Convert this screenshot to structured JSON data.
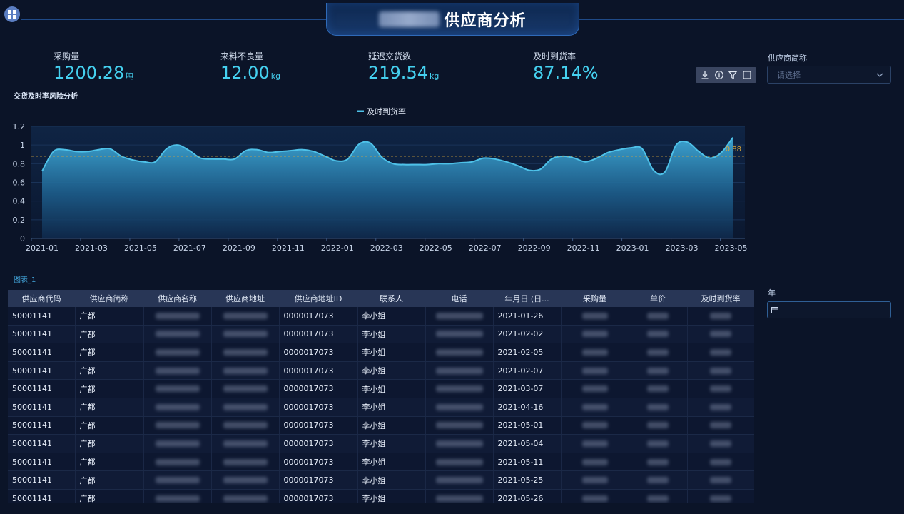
{
  "header": {
    "title": "供应商分析",
    "menu_icon": "grid-icon"
  },
  "kpis": [
    {
      "label": "采购量",
      "value": "1200.28",
      "unit": "吨"
    },
    {
      "label": "来料不良量",
      "value": "12.00",
      "unit": "kg"
    },
    {
      "label": "延迟交货数",
      "value": "219.54",
      "unit": "kg"
    },
    {
      "label": "及时到货率",
      "value": "87.14%",
      "unit": ""
    }
  ],
  "toolbar": {
    "icons": [
      "download-icon",
      "info-icon",
      "filter-icon",
      "fullscreen-icon"
    ]
  },
  "filters": {
    "supplier": {
      "label": "供应商简称",
      "placeholder": "请选择"
    },
    "year": {
      "label": "年",
      "value": ""
    }
  },
  "chart": {
    "section_title": "交货及时率风险分析",
    "legend": "及时到货率",
    "reference_label": "0.88"
  },
  "chart_data": {
    "type": "area",
    "series": [
      {
        "name": "及时到货率",
        "values": [
          0.72,
          0.93,
          0.95,
          0.93,
          0.93,
          0.95,
          0.96,
          0.88,
          0.84,
          0.82,
          0.82,
          0.96,
          1.0,
          0.94,
          0.86,
          0.85,
          0.85,
          0.85,
          0.94,
          0.95,
          0.92,
          0.93,
          0.94,
          0.95,
          0.93,
          0.88,
          0.83,
          0.85,
          1.01,
          1.02,
          0.87,
          0.8,
          0.79,
          0.79,
          0.79,
          0.8,
          0.8,
          0.81,
          0.82,
          0.86,
          0.85,
          0.82,
          0.78,
          0.73,
          0.74,
          0.85,
          0.88,
          0.86,
          0.82,
          0.86,
          0.92,
          0.95,
          0.97,
          0.96,
          0.73,
          0.71,
          1.0,
          1.03,
          0.93,
          0.86,
          0.92,
          1.08
        ],
        "color": "#4ec1e8"
      }
    ],
    "x_ticks": [
      "2021-01",
      "2021-03",
      "2021-05",
      "2021-07",
      "2021-09",
      "2021-11",
      "2022-01",
      "2022-03",
      "2022-05",
      "2022-07",
      "2022-09",
      "2022-11",
      "2023-01",
      "2023-03",
      "2023-05"
    ],
    "y_ticks": [
      "0",
      "0.2",
      "0.4",
      "0.6",
      "0.8",
      "1",
      "1.2"
    ],
    "x_range": [
      "2021-01",
      "2023-06"
    ],
    "ylim": [
      0,
      1.2
    ],
    "reference_line": 0.88,
    "reference_color": "#d8a53a",
    "legend_position": "top-center",
    "grid": false
  },
  "table": {
    "title": "图表_1",
    "columns": [
      "供应商代码",
      "供应商简称",
      "供应商名称",
      "供应商地址",
      "供应商地址ID",
      "联系人",
      "电话",
      "年月日 (日...",
      "采购量",
      "单价",
      "及时到货率"
    ],
    "rows": [
      [
        "50001141",
        "广都",
        "",
        "",
        "0000017073",
        "李小姐",
        "",
        "2021-01-26",
        "",
        "",
        ""
      ],
      [
        "50001141",
        "广都",
        "",
        "",
        "0000017073",
        "李小姐",
        "",
        "2021-02-02",
        "",
        "",
        ""
      ],
      [
        "50001141",
        "广都",
        "",
        "",
        "0000017073",
        "李小姐",
        "",
        "2021-02-05",
        "",
        "",
        ""
      ],
      [
        "50001141",
        "广都",
        "",
        "",
        "0000017073",
        "李小姐",
        "",
        "2021-02-07",
        "",
        "",
        ""
      ],
      [
        "50001141",
        "广都",
        "",
        "",
        "0000017073",
        "李小姐",
        "",
        "2021-03-07",
        "",
        "",
        ""
      ],
      [
        "50001141",
        "广都",
        "",
        "",
        "0000017073",
        "李小姐",
        "",
        "2021-04-16",
        "",
        "",
        ""
      ],
      [
        "50001141",
        "广都",
        "",
        "",
        "0000017073",
        "李小姐",
        "",
        "2021-05-01",
        "",
        "",
        ""
      ],
      [
        "50001141",
        "广都",
        "",
        "",
        "0000017073",
        "李小姐",
        "",
        "2021-05-04",
        "",
        "",
        ""
      ],
      [
        "50001141",
        "广都",
        "",
        "",
        "0000017073",
        "李小姐",
        "",
        "2021-05-11",
        "",
        "",
        ""
      ],
      [
        "50001141",
        "广都",
        "",
        "",
        "0000017073",
        "李小姐",
        "",
        "2021-05-25",
        "",
        "",
        ""
      ],
      [
        "50001141",
        "广都",
        "",
        "",
        "0000017073",
        "李小姐",
        "",
        "2021-05-26",
        "",
        "",
        ""
      ]
    ]
  }
}
